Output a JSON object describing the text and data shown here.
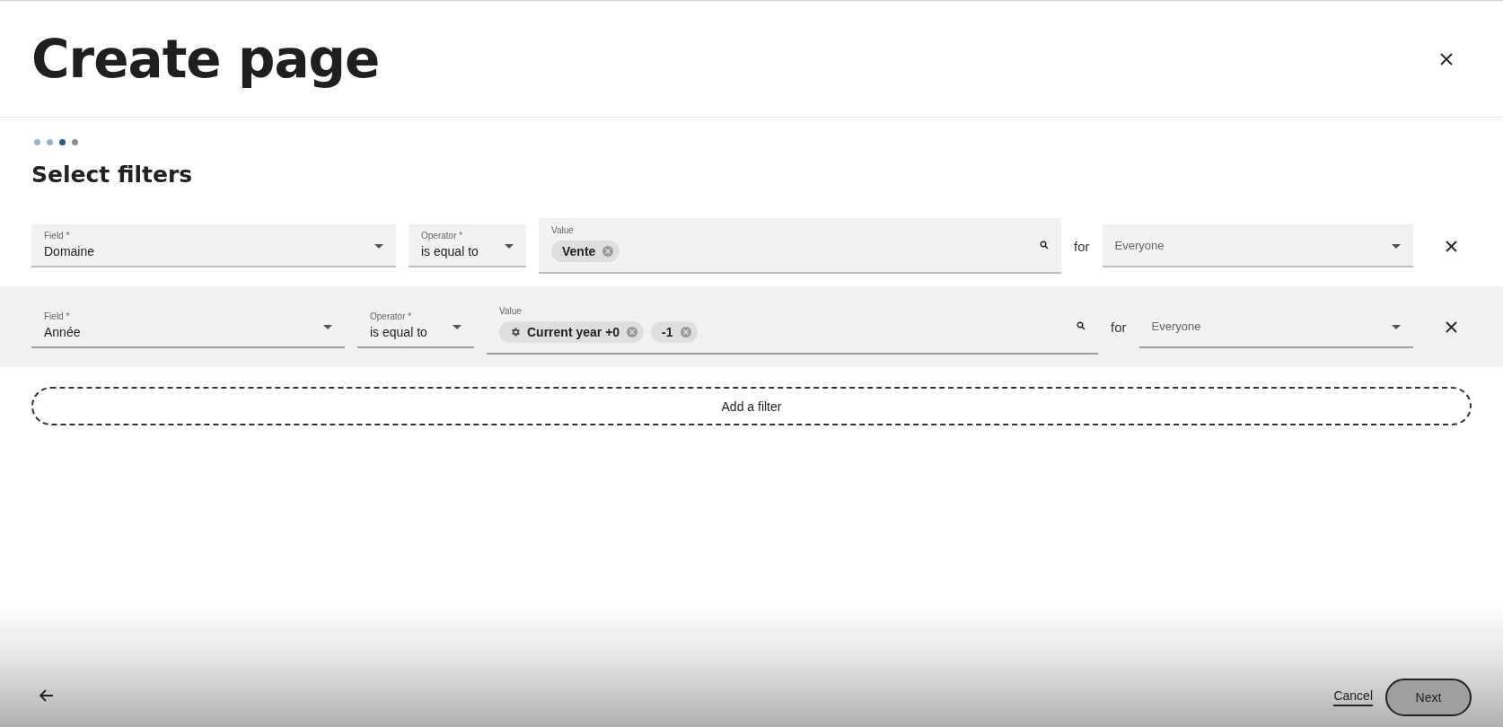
{
  "dialog": {
    "title": "Create page"
  },
  "steps": [
    {
      "completed": true,
      "selected": false
    },
    {
      "completed": true,
      "selected": false
    },
    {
      "completed": false,
      "selected": true
    },
    {
      "completed": false,
      "selected": false
    }
  ],
  "section_title": "Select filters",
  "filters": [
    {
      "highlighted": false,
      "field": {
        "label": "Field *",
        "value": "Domaine"
      },
      "operator": {
        "label": "Operator *",
        "value": "is equal to"
      },
      "value": {
        "label": "Value",
        "chips": [
          {
            "kind": "plain",
            "text": "Vente"
          }
        ]
      },
      "for_label": "for",
      "audience": {
        "placeholder": "Everyone"
      }
    },
    {
      "highlighted": true,
      "field": {
        "label": "Field *",
        "value": "Année"
      },
      "operator": {
        "label": "Operator *",
        "value": "is equal to"
      },
      "value": {
        "label": "Value",
        "chips": [
          {
            "kind": "dynamic",
            "text": "Current year +0"
          },
          {
            "kind": "plain",
            "text": "-1"
          }
        ]
      },
      "for_label": "for",
      "audience": {
        "placeholder": "Everyone"
      }
    }
  ],
  "add_filter": "Add a filter",
  "footer": {
    "cancel": "Cancel",
    "next": "Next"
  }
}
